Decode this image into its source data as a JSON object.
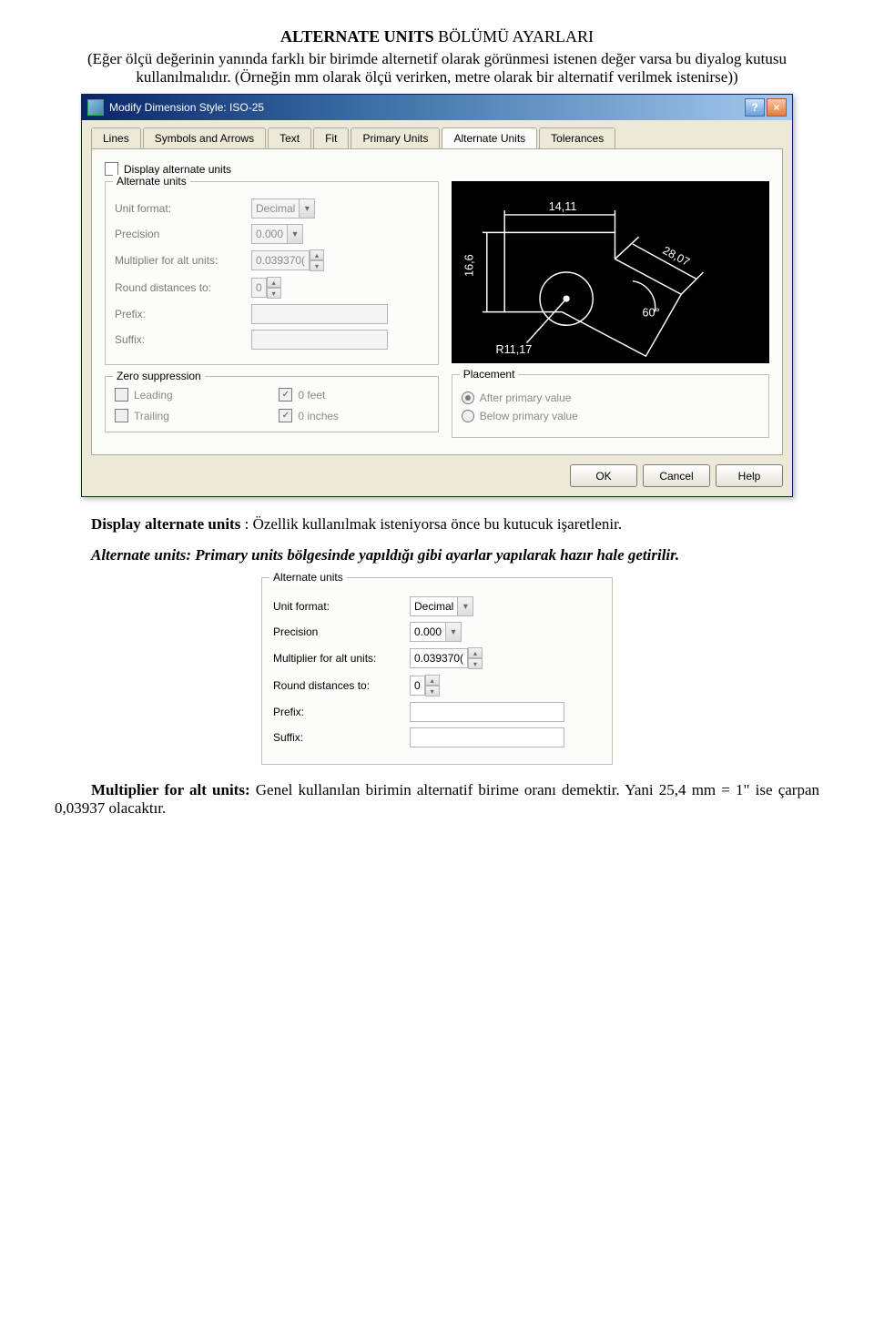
{
  "heading_part1": "ALTERNATE UNITS",
  "heading_part2": " BÖLÜMÜ AYARLARI",
  "desc_line1": "(Eğer ölçü değerinin yanında farklı bir birimde alternetif olarak görünmesi istenen değer varsa bu diyalog kutusu kullanılmalıdır. (Örneğin mm olarak ölçü verirken, metre olarak bir alternatif verilmek istenirse))",
  "dialog": {
    "title": "Modify Dimension Style: ISO-25",
    "tabs": [
      "Lines",
      "Symbols and Arrows",
      "Text",
      "Fit",
      "Primary Units",
      "Alternate Units",
      "Tolerances"
    ],
    "active_tab": 5,
    "display_alt_units": "Display alternate units",
    "alt_units": {
      "legend": "Alternate units",
      "unit_format_label": "Unit format:",
      "unit_format_value": "Decimal",
      "precision_label": "Precision",
      "precision_value": "0.000",
      "mult_label": "Multiplier for alt units:",
      "mult_value": "0.039370(",
      "round_label": "Round distances to:",
      "round_value": "0",
      "prefix_label": "Prefix:",
      "prefix_value": "",
      "suffix_label": "Suffix:",
      "suffix_value": ""
    },
    "zero": {
      "legend": "Zero suppression",
      "leading": "Leading",
      "trailing": "Trailing",
      "feet": "0 feet",
      "inches": "0 inches"
    },
    "placement": {
      "legend": "Placement",
      "after": "After primary value",
      "below": "Below primary value"
    },
    "preview": {
      "d_top": "14,11",
      "d_left": "16,6",
      "d_diag": "28,07",
      "d_angle": "60°",
      "d_radius": "R11,17"
    },
    "buttons": {
      "ok": "OK",
      "cancel": "Cancel",
      "help": "Help"
    }
  },
  "body": {
    "p1_bold": "Display alternate units",
    "p1_colon": " : ",
    "p1_rest": "Özellik kullanılmak isteniyorsa önce bu kutucuk işaretlenir.",
    "p2_italic": "Alternate units: Primary units bölgesinde yapıldığı gibi ayarlar yapılarak hazır hale getirilir.",
    "p3_bold": "Multiplier for alt units:",
    "p3_rest": " Genel kullanılan birimin alternatif birime oranı demektir. Yani 25,4 mm = 1\" ise çarpan 0,03937 olacaktır."
  },
  "mini": {
    "legend": "Alternate units",
    "unit_format_label": "Unit format:",
    "unit_format_value": "Decimal",
    "precision_label": "Precision",
    "precision_value": "0.000",
    "mult_label": "Multiplier for alt units:",
    "mult_value": "0.039370(",
    "round_label": "Round distances to:",
    "round_value": "0",
    "prefix_label": "Prefix:",
    "prefix_value": "",
    "suffix_label": "Suffix:",
    "suffix_value": ""
  }
}
